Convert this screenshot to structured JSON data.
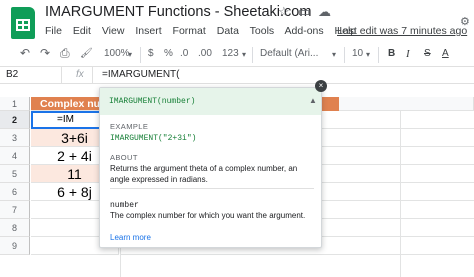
{
  "app": {
    "doc_title": "IMARGUMENT Functions - Sheetaki.com",
    "last_edit": "Last edit was 7 minutes ago",
    "menu": [
      "File",
      "Edit",
      "View",
      "Insert",
      "Format",
      "Data",
      "Tools",
      "Add-ons",
      "Help"
    ],
    "icons": [
      "star-icon",
      "folder-icon",
      "cloud-icon",
      "gear-icon"
    ]
  },
  "toolbar": {
    "undo": "↶",
    "redo": "↷",
    "print": "⎙",
    "paint": "🖌",
    "zoom": "100%",
    "currency": "$",
    "percent": "%",
    "dec_less": ".0",
    "dec_more": ".00",
    "number_format": "123",
    "font": "Default (Ari...",
    "font_size": "10",
    "bold": "B",
    "italic": "I",
    "strike": "S",
    "text_color": "A"
  },
  "formula_bar": {
    "cell_ref": "B2",
    "fx": "fx",
    "formula": "=IMARGUMENT("
  },
  "sheet": {
    "rows": [
      {
        "num": "1",
        "value": "Complex numb",
        "style": "header"
      },
      {
        "num": "2",
        "value": "=IM",
        "style": "selected"
      },
      {
        "num": "3",
        "value": "3+6i",
        "style": "peach"
      },
      {
        "num": "4",
        "value": "2 + 4i",
        "style": "plain"
      },
      {
        "num": "5",
        "value": "11",
        "style": "peach"
      },
      {
        "num": "6",
        "value": "6 + 8j",
        "style": "plain"
      },
      {
        "num": "7",
        "value": "",
        "style": "plain"
      },
      {
        "num": "8",
        "value": "",
        "style": "plain"
      },
      {
        "num": "9",
        "value": "",
        "style": "plain"
      }
    ],
    "colors": {
      "header_bg": "#e0814f",
      "peach": "#fce8df",
      "selection": "#1a73e8"
    }
  },
  "popup": {
    "signature": "IMARGUMENT(number)",
    "example_label": "EXAMPLE",
    "example": "IMARGUMENT(\"2+3i\")",
    "about_label": "ABOUT",
    "about": "Returns the argument theta of a complex number, an angle expressed in radians.",
    "param_name": "number",
    "param_desc": "The complex number for which you want the argument.",
    "learn_more": "Learn more",
    "close": "×"
  }
}
